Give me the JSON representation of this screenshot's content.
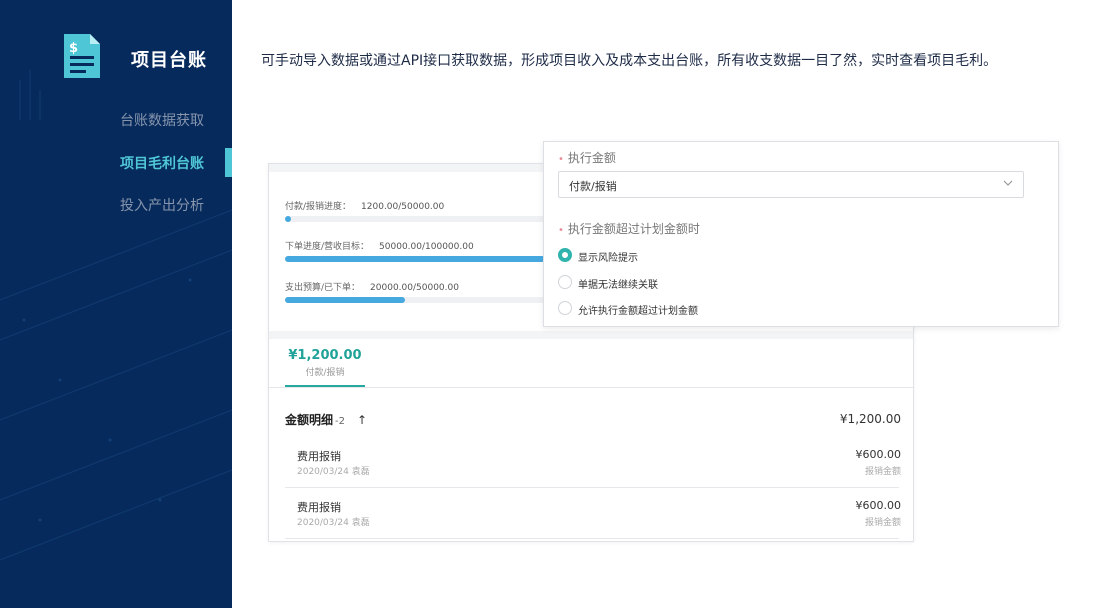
{
  "sidebar": {
    "brand": "项目台账",
    "nav": [
      {
        "label": "台账数据获取"
      },
      {
        "label": "项目毛利台账"
      },
      {
        "label": "投入产出分析"
      }
    ]
  },
  "headline": "可手动导入数据或通过API接口获取数据，形成项目收入及成本支出台账，所有收支数据一目了然，实时查看项目毛利。",
  "card": {
    "progress": [
      {
        "label": "付款/报销进度：",
        "value": "1200.00/50000.00",
        "fill": 0.012
      },
      {
        "label": "下单进度/营收目标：",
        "value": "50000.00/100000.00",
        "fill": 0.5
      },
      {
        "label": "支出预算/已下单：",
        "value": "20000.00/50000.00",
        "fill": 0.23
      }
    ],
    "tab": {
      "amount": "¥1,200.00",
      "label": "付款/报销"
    },
    "section": {
      "title": "金额明细",
      "count": "-2",
      "arrow": "↑",
      "total": "¥1,200.00"
    },
    "rows": [
      {
        "title": "费用报销",
        "sub": "2020/03/24 袁磊",
        "amount": "¥600.00",
        "amount_label": "报销金额"
      },
      {
        "title": "费用报销",
        "sub": "2020/03/24 袁磊",
        "amount": "¥600.00",
        "amount_label": "报销金额"
      }
    ]
  },
  "panel": {
    "field1_label": "执行金额",
    "field1_value": "付款/报销",
    "field2_label": "执行金额超过计划金额时",
    "options": [
      {
        "label": "显示风险提示",
        "selected": true
      },
      {
        "label": "单据无法继续关联",
        "selected": false
      },
      {
        "label": "允许执行金额超过计划金额",
        "selected": false
      }
    ]
  },
  "colors": {
    "sidebar_bg": "#062a5c",
    "accent": "#4fc6d6",
    "teal": "#2fb3ad",
    "bar": "#45a8df"
  }
}
